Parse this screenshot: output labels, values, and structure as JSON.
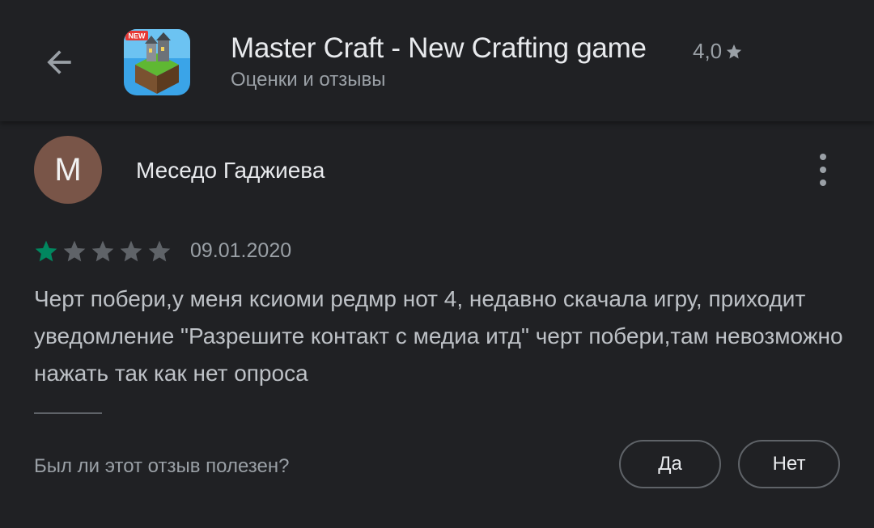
{
  "header": {
    "app_title": "Master Craft - New Crafting game",
    "rating": "4,0",
    "rating_icon": "star-icon",
    "subtitle": "Оценки и отзывы",
    "app_icon_badge": "NEW"
  },
  "review": {
    "avatar_letter": "M",
    "avatar_color": "#795548",
    "author": "Меседо Гаджиева",
    "stars_filled": 1,
    "stars_total": 5,
    "star_filled_color": "#01875f",
    "star_empty_color": "#5f6368",
    "date": "09.01.2020",
    "text": "Черт побери,у меня ксиоми редмр нот 4, недавно скачала игру, приходит уведомление \"Разрешите контакт с медиа итд\" черт побери,там невозможно нажать так как нет опроса"
  },
  "feedback": {
    "question": "Был ли этот отзыв полезен?",
    "yes_label": "Да",
    "no_label": "Нет"
  }
}
